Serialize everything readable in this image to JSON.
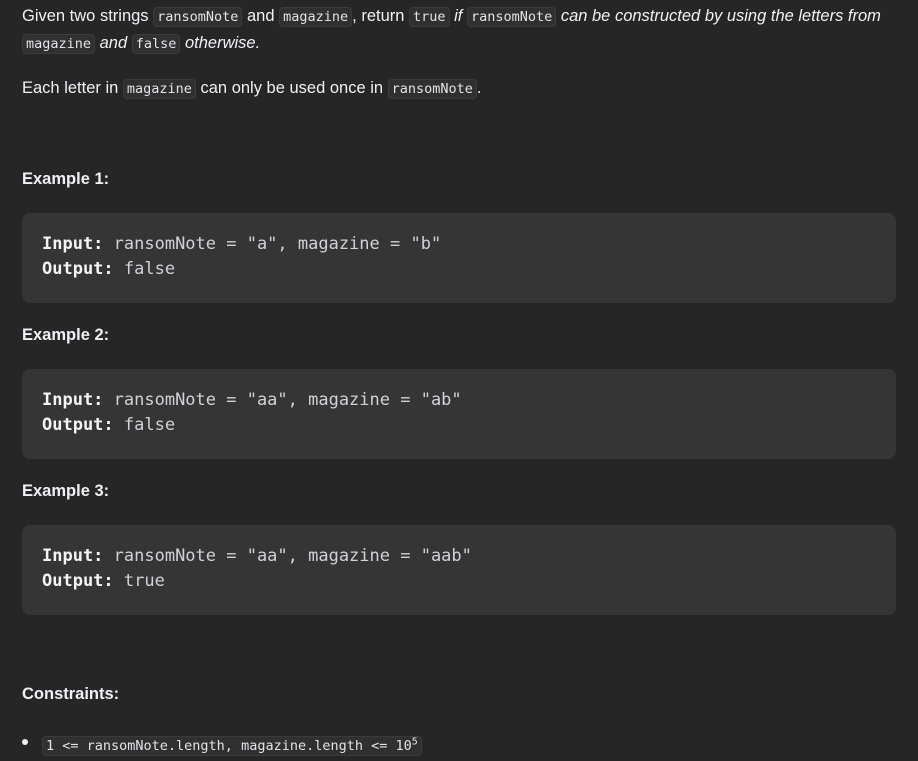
{
  "description": {
    "p1_given": "Given two strings ",
    "p1_code1": "ransomNote",
    "p1_and": " and ",
    "p1_code2": "magazine",
    "p1_return": ", return ",
    "p1_code3": "true",
    "p1_if": " if ",
    "p1_code4": "ransomNote",
    "p1_can": " can be constructed by using the letters from ",
    "p1_code5": "magazine",
    "p1_and2": " and ",
    "p1_code6": "false",
    "p1_otherwise": " otherwise.",
    "p2_each": "Each letter in ",
    "p2_code1": "magazine",
    "p2_can": " can only be used once in ",
    "p2_code2": "ransomNote",
    "p2_end": "."
  },
  "examples": [
    {
      "heading": "Example 1:",
      "input_label": "Input:",
      "input_value": " ransomNote = \"a\", magazine = \"b\"",
      "output_label": "Output:",
      "output_value": " false"
    },
    {
      "heading": "Example 2:",
      "input_label": "Input:",
      "input_value": " ransomNote = \"aa\", magazine = \"ab\"",
      "output_label": "Output:",
      "output_value": " false"
    },
    {
      "heading": "Example 3:",
      "input_label": "Input:",
      "input_value": " ransomNote = \"aa\", magazine = \"aab\"",
      "output_label": "Output:",
      "output_value": " true"
    }
  ],
  "constraints": {
    "heading": "Constraints:",
    "items": [
      {
        "text": "1 <= ransomNote.length, magazine.length <= 10",
        "sup": "5"
      }
    ]
  }
}
